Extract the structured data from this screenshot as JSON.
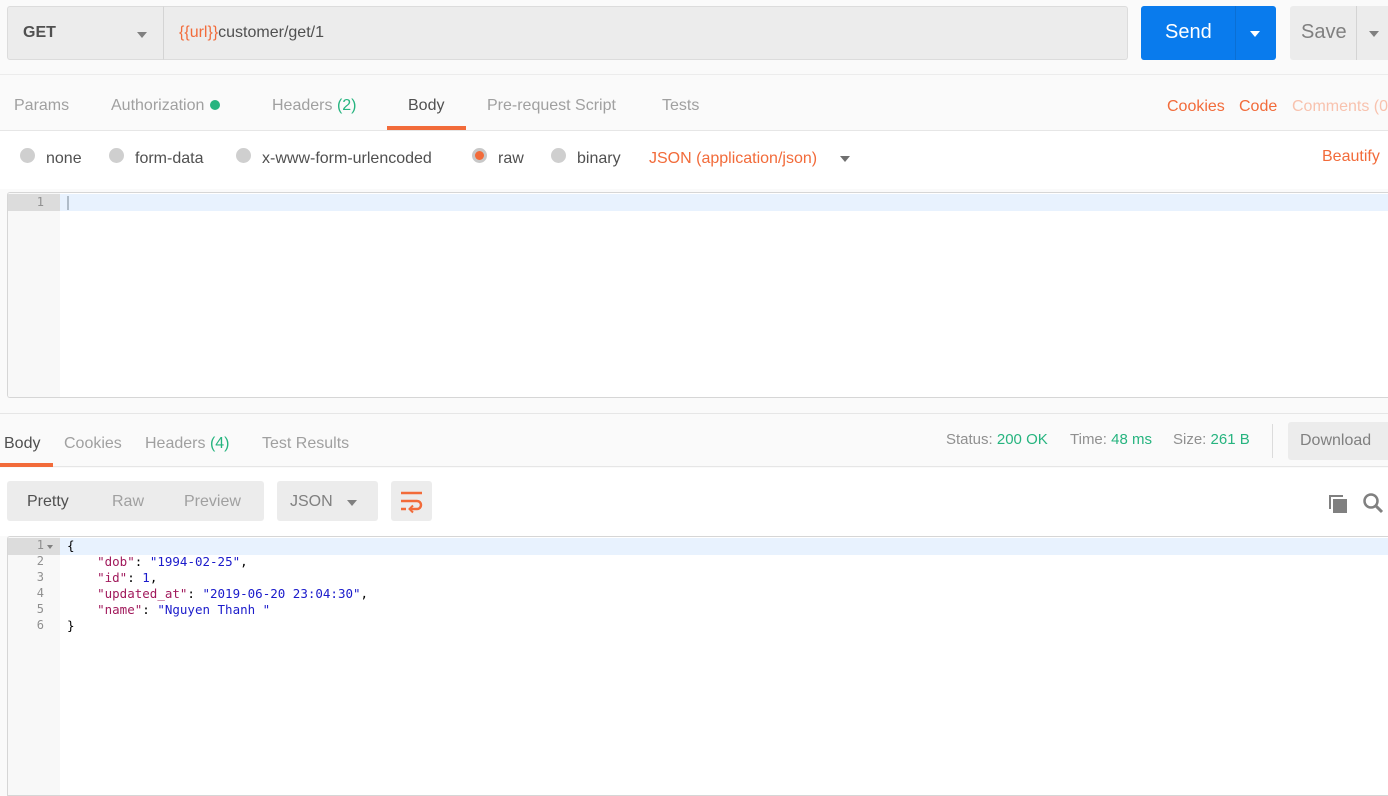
{
  "request": {
    "method": "GET",
    "url_variable": "{{url}}",
    "url_path": "customer/get/1",
    "send_label": "Send",
    "save_label": "Save"
  },
  "request_tabs": [
    {
      "label": "Params",
      "active": false
    },
    {
      "label": "Authorization",
      "active": false,
      "indicator": "green-dot"
    },
    {
      "label": "Headers",
      "count": "(2)",
      "active": false
    },
    {
      "label": "Body",
      "active": true
    },
    {
      "label": "Pre-request Script",
      "active": false
    },
    {
      "label": "Tests",
      "active": false
    }
  ],
  "request_links": {
    "cookies": "Cookies",
    "code": "Code",
    "comments": "Comments (0"
  },
  "body_types": [
    {
      "label": "none",
      "selected": false
    },
    {
      "label": "form-data",
      "selected": false
    },
    {
      "label": "x-www-form-urlencoded",
      "selected": false
    },
    {
      "label": "raw",
      "selected": true
    },
    {
      "label": "binary",
      "selected": false
    }
  ],
  "content_type": "JSON (application/json)",
  "beautify_label": "Beautify",
  "request_editor": {
    "lines": [
      "1"
    ]
  },
  "response_tabs": [
    {
      "label": "Body",
      "active": true
    },
    {
      "label": "Cookies",
      "active": false
    },
    {
      "label": "Headers",
      "count": "(4)",
      "active": false
    },
    {
      "label": "Test Results",
      "active": false
    }
  ],
  "response_meta": {
    "status_label": "Status:",
    "status_value": "200 OK",
    "time_label": "Time:",
    "time_value": "48 ms",
    "size_label": "Size:",
    "size_value": "261 B",
    "download_label": "Download"
  },
  "response_view": {
    "modes": [
      "Pretty",
      "Raw",
      "Preview"
    ],
    "active_mode": "Pretty",
    "format": "JSON"
  },
  "icons": {
    "wrap": "wrap-lines-icon",
    "copy": "copy-icon",
    "search": "search-icon"
  },
  "colors": {
    "accent": "#f26b3a",
    "primary": "#097bed",
    "success": "#26b47f"
  },
  "response_body": {
    "line_numbers": [
      "1",
      "2",
      "3",
      "4",
      "5",
      "6"
    ],
    "open_brace": "{",
    "close_brace": "}",
    "fields": [
      {
        "key": "\"dob\"",
        "value": "\"1994-02-25\"",
        "comma": ","
      },
      {
        "key": "\"id\"",
        "value": "1",
        "comma": ","
      },
      {
        "key": "\"updated_at\"",
        "value": "\"2019-06-20 23:04:30\"",
        "comma": ","
      },
      {
        "key": "\"name\"",
        "value": "\"Nguyen Thanh \"",
        "comma": ""
      }
    ]
  }
}
